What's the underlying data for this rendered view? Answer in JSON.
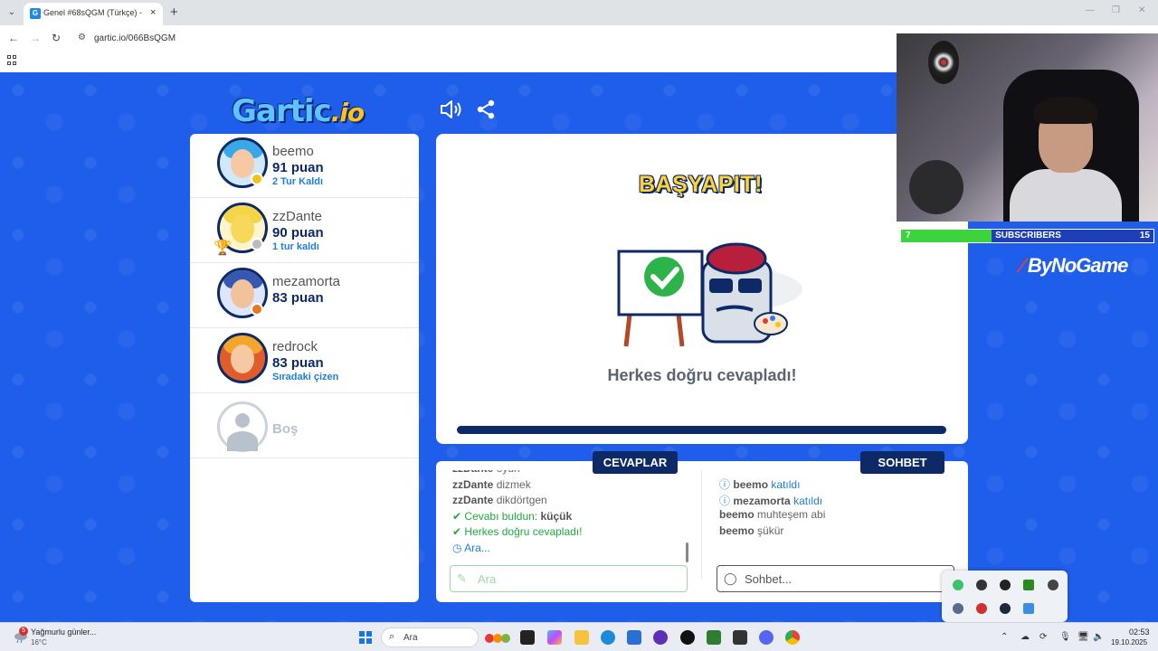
{
  "browser": {
    "tab_title": "Genel #68sQGM (Türkçe) - Gartic.io",
    "url": "gartic.io/066BsQGM",
    "new_tab": "+",
    "close_tab": "×"
  },
  "game": {
    "logo_main": "Gartic",
    "logo_suffix": ".io",
    "players": [
      {
        "name": "beemo",
        "score": "91 puan",
        "note": "2 Tur Kaldı",
        "status_color": "#f3c21b",
        "hair": "#3aa7e8",
        "skin": "#f6c9a3"
      },
      {
        "name": "zzDante",
        "score": "90 puan",
        "note": "1 tur kaldı",
        "status_color": "#bbbbbb",
        "hair": "#f5d548",
        "skin": "#f7d85b"
      },
      {
        "name": "mezamorta",
        "score": "83 puan",
        "note": "",
        "status_color": "#e8771d",
        "hair": "#3559b3",
        "skin": "#f2c29b"
      },
      {
        "name": "redrock",
        "score": "83 puan",
        "note": "Sıradaki çizen",
        "status_color": "",
        "hair": "#f4a52b",
        "skin": "#f6c9a3"
      }
    ],
    "empty_slot": "Boş",
    "board": {
      "banner": "BAŞYAPIT!",
      "message": "Herkes doğru cevapladı!"
    },
    "answers": {
      "tab": "CEVAPLAR",
      "lines": [
        {
          "user": "zzDante",
          "text": "oyun"
        },
        {
          "user": "zzDante",
          "text": "dizmek"
        },
        {
          "user": "zzDante",
          "text": "dikdörtgen"
        }
      ],
      "found_prefix": "Cevabı buldun: ",
      "found_word": "küçük",
      "all_correct": "Herkes doğru cevapladı!",
      "timer_text": "Ara...",
      "input_placeholder": "Ara"
    },
    "chat": {
      "tab": "SOHBET",
      "joined": [
        {
          "user": "beemo",
          "text": "katıldı"
        },
        {
          "user": "mezamorta",
          "text": "katıldı"
        }
      ],
      "messages": [
        {
          "user": "beemo",
          "text": "muhteşem abi"
        },
        {
          "user": "beemo",
          "text": "şükür"
        }
      ],
      "input_placeholder": "Sohbet..."
    }
  },
  "stream": {
    "subs_start": "7",
    "subs_label": "SUBSCRIBERS",
    "subs_goal": "15",
    "subs_progress": 0.36,
    "brand": "ByNoGame"
  },
  "taskbar": {
    "weather_badge": "5",
    "weather_text": "Yağmurlu günler...",
    "weather_temp": "16°C",
    "search_placeholder": "Ara",
    "time": "02:53",
    "date": "19.10.2025"
  },
  "colors": {
    "game_bg": "#1f5eea",
    "navy": "#0d2a66",
    "accent_green": "#1faa3d",
    "accent_blue": "#1e7ed8"
  }
}
